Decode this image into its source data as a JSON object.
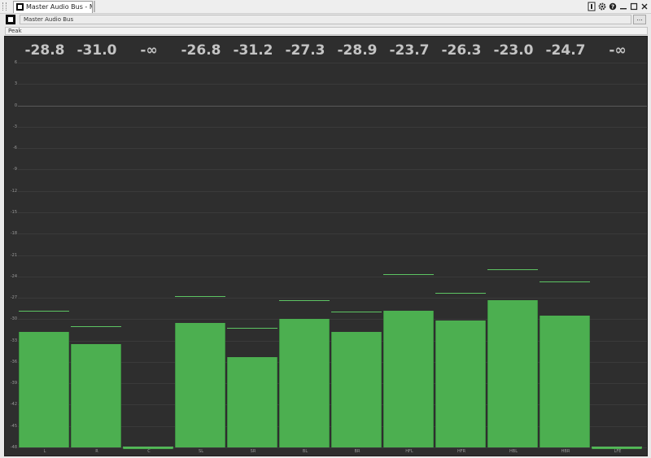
{
  "window": {
    "tab_title": "Master Audio Bus - Meter"
  },
  "toolbar": {
    "bus_name": "Master Audio Bus",
    "more_label": "..."
  },
  "mode": {
    "selected": "Peak"
  },
  "icons": {
    "tab": "meter-window-icon",
    "toolbar": "meter-window-icon",
    "window_buttons": [
      "info-icon",
      "gear-icon",
      "help-icon",
      "minimize-icon",
      "maximize-icon",
      "close-icon"
    ]
  },
  "colors": {
    "bar": "#4caf50",
    "hold": "#5dc463",
    "background": "#2e2e2e",
    "peak_text": "#c4c4c4"
  },
  "chart_data": {
    "type": "bar",
    "categories": [
      "L",
      "R",
      "C",
      "SL",
      "SR",
      "BL",
      "BR",
      "HFL",
      "HFR",
      "HBL",
      "HBR",
      "LFE"
    ],
    "peak_labels": [
      "-28.8",
      "-31.0",
      "-∞",
      "-26.8",
      "-31.2",
      "-27.3",
      "-28.9",
      "-23.7",
      "-26.3",
      "-23.0",
      "-24.7",
      "-∞"
    ],
    "series": [
      {
        "values": [
          -31.8,
          -33.5,
          -48,
          -30.5,
          -35.3,
          -30.0,
          -31.8,
          -28.8,
          -30.2,
          -27.3,
          -29.5,
          -48
        ]
      },
      {
        "values": [
          -28.8,
          -31.0,
          -48,
          -26.8,
          -31.2,
          -27.3,
          -28.9,
          -23.7,
          -26.3,
          -23.0,
          -24.7,
          -48
        ]
      }
    ],
    "ylim": [
      -48,
      6
    ],
    "yticks": [
      "6",
      "3",
      "0",
      "-3",
      "-6",
      "-9",
      "-12",
      "-15",
      "-18",
      "-21",
      "-24",
      "-27",
      "-30",
      "-33",
      "-36",
      "-39",
      "-42",
      "-45",
      "-48"
    ],
    "grid": true
  }
}
